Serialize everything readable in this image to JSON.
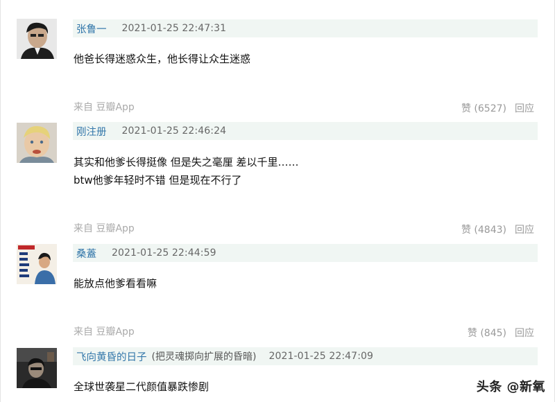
{
  "comments": [
    {
      "author": "张鲁一",
      "signature": "",
      "time": "2021-01-25 22:47:31",
      "lines": [
        "他爸长得迷惑众生，他长得让众生迷惑"
      ],
      "source": "来自 豆瓣App",
      "likes": "赞 (6527)",
      "reply": "回应"
    },
    {
      "author": "刚注册",
      "signature": "",
      "time": "2021-01-25 22:46:24",
      "lines": [
        "其实和他爹长得挺像 但是失之毫厘 差以千里……",
        "btw他爹年轻时不错 但是现在不行了"
      ],
      "source": "来自 豆瓣App",
      "likes": "赞 (4843)",
      "reply": "回应"
    },
    {
      "author": "桑蓋",
      "signature": "",
      "time": "2021-01-25 22:44:59",
      "lines": [
        "能放点他爹看看嘛"
      ],
      "source": "来自 豆瓣App",
      "likes": "赞 (845)",
      "reply": "回应"
    },
    {
      "author": "飞向黄昏的日子",
      "signature": "(把灵魂掷向扩展的昏暗)",
      "time": "2021-01-25 22:47:09",
      "lines": [
        "全球世袭星二代颜值暴跌惨剧"
      ],
      "source": "",
      "likes": "",
      "reply": ""
    }
  ],
  "watermark": "头条 @新氧"
}
